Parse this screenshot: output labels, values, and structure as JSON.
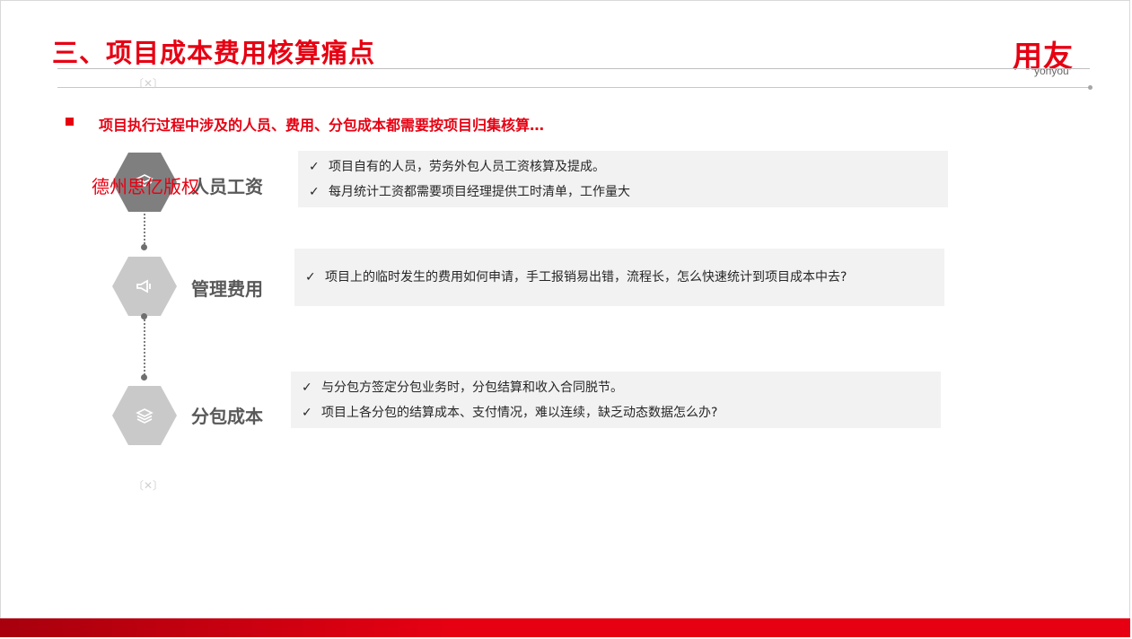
{
  "slide": {
    "title": "三、项目成本费用核算痛点",
    "logo": {
      "cn": "用友",
      "en": "yonyou"
    },
    "headline": "项目执行过程中涉及的人员、费用、分包成本都需要按项目归集核算…",
    "watermark": "德州思亿版权",
    "accent_color": "#e60012"
  },
  "categories": [
    {
      "label": "人员工资",
      "icon": "layers-icon",
      "points": [
        "项目自有的人员，劳务外包人员工资核算及提成。",
        "每月统计工资都需要项目经理提供工时清单，工作量大"
      ]
    },
    {
      "label": "管理费用",
      "icon": "megaphone-icon",
      "points": [
        "项目上的临时发生的费用如何申请，手工报销易出错，流程长，怎么快速统计到项目成本中去?"
      ]
    },
    {
      "label": "分包成本",
      "icon": "stack-icon",
      "points": [
        "与分包方签定分包业务时，分包结算和收入合同脱节。",
        "项目上各分包的结算成本、支付情况，难以连续，缺乏动态数据怎么办?"
      ]
    }
  ],
  "check_glyph": "✓"
}
